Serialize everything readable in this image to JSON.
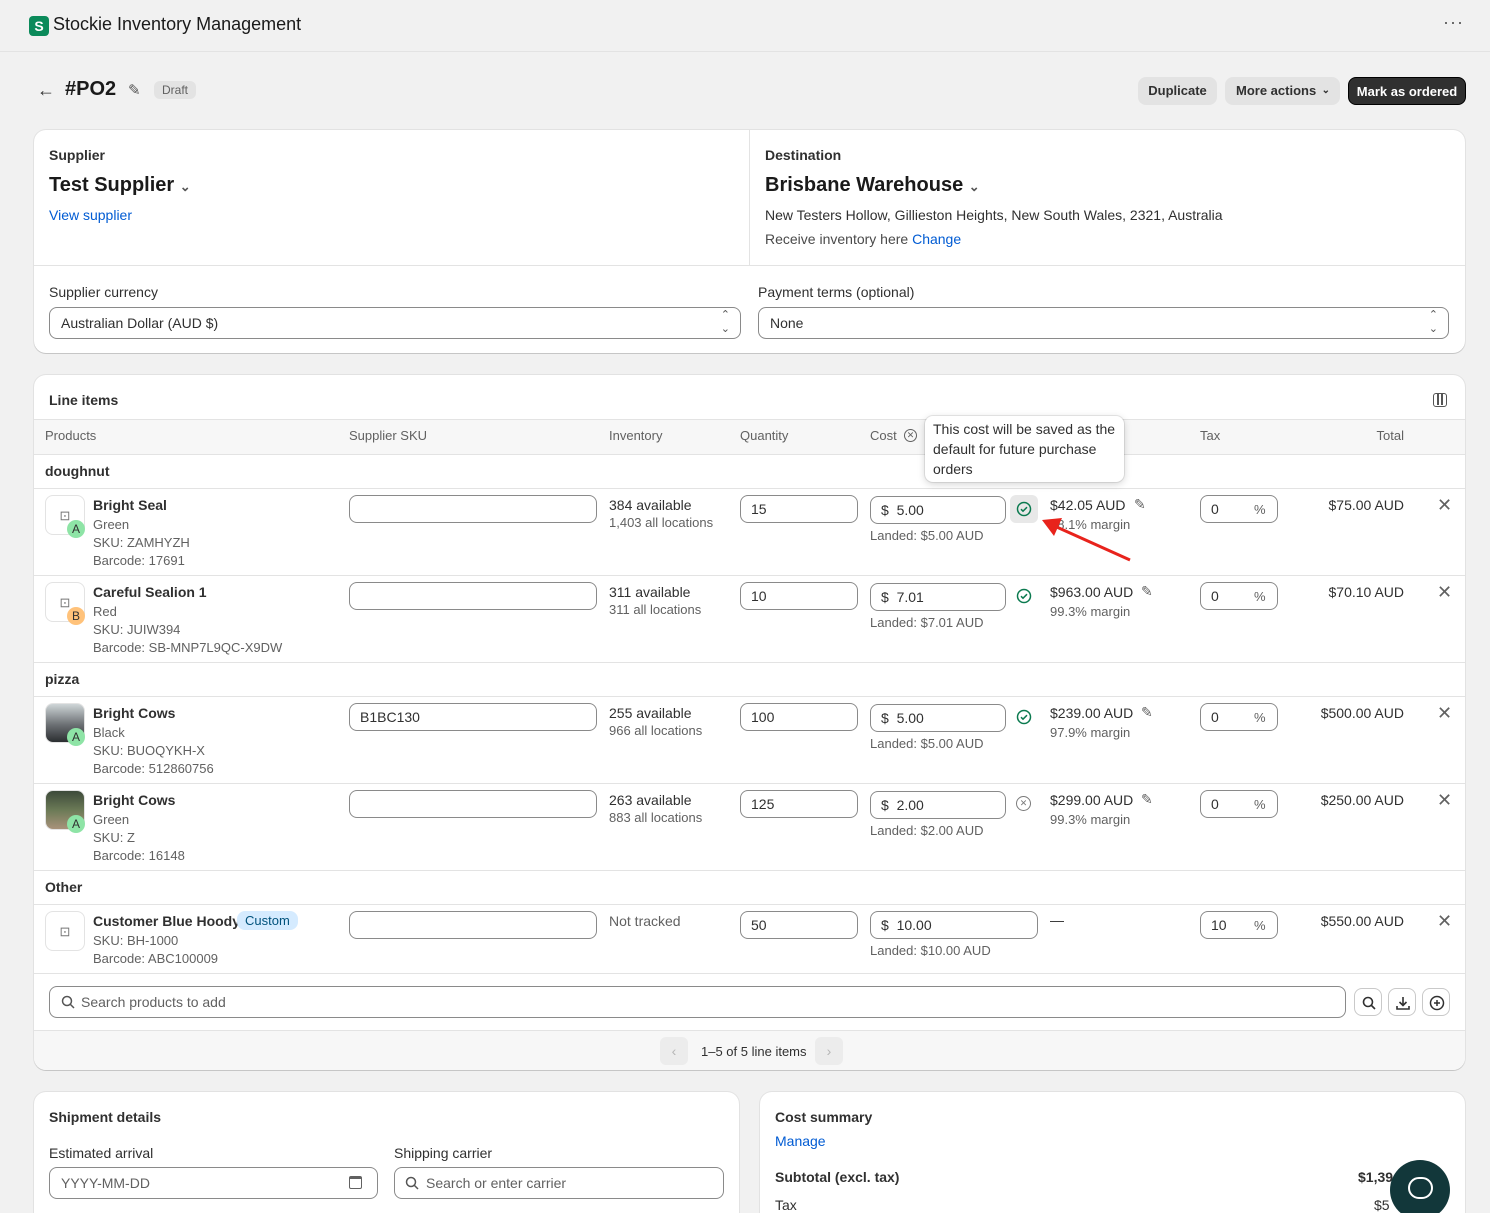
{
  "app": {
    "title": "Stockie Inventory Management",
    "logo_letter": "S"
  },
  "header": {
    "po_number": "#PO2",
    "status": "Draft",
    "duplicate_label": "Duplicate",
    "more_actions_label": "More actions",
    "mark_ordered_label": "Mark as ordered"
  },
  "supplier": {
    "label": "Supplier",
    "name": "Test Supplier",
    "view_link": "View supplier"
  },
  "destination": {
    "label": "Destination",
    "name": "Brisbane Warehouse",
    "address": "New Testers Hollow, Gillieston Heights, New South Wales, 2321, Australia",
    "receive_text": "Receive inventory here",
    "change_link": "Change"
  },
  "currency": {
    "label": "Supplier currency",
    "value": "Australian Dollar (AUD $)"
  },
  "payment_terms": {
    "label": "Payment terms (optional)",
    "value": "None"
  },
  "line_items": {
    "title": "Line items",
    "columns": {
      "products": "Products",
      "sku": "Supplier SKU",
      "inventory": "Inventory",
      "quantity": "Quantity",
      "cost": "Cost",
      "tax": "Tax",
      "total": "Total"
    },
    "tooltip": "This cost will be saved as the default for future purchase orders",
    "groups": [
      "doughnut",
      "pizza",
      "Other"
    ],
    "rows": [
      {
        "name": "Bright Seal",
        "variant": "Green",
        "sku": "SKU: ZAMHYZH",
        "barcode": "Barcode: 17691",
        "badge": "A",
        "supplier_sku": "",
        "available": "384 available",
        "all_locations": "1,403 all locations",
        "quantity": "15",
        "currency_symbol": "$",
        "cost": "5.00",
        "landed": "Landed: $5.00 AUD",
        "price": "$42.05 AUD",
        "margin": "88.1% margin",
        "tax": "0",
        "pct": "%",
        "total": "$75.00 AUD"
      },
      {
        "name": "Careful Sealion 1",
        "variant": "Red",
        "sku": "SKU: JUIW394",
        "barcode": "Barcode: SB-MNP7L9QC-X9DW",
        "badge": "B",
        "supplier_sku": "",
        "available": "311 available",
        "all_locations": "311 all locations",
        "quantity": "10",
        "currency_symbol": "$",
        "cost": "7.01",
        "landed": "Landed: $7.01 AUD",
        "price": "$963.00 AUD",
        "margin": "99.3% margin",
        "tax": "0",
        "pct": "%",
        "total": "$70.10 AUD"
      },
      {
        "name": "Bright Cows",
        "variant": "Black",
        "sku": "SKU: BUOQYKH-X",
        "barcode": "Barcode: 512860756",
        "badge": "A",
        "supplier_sku": "B1BC130",
        "available": "255 available",
        "all_locations": "966 all locations",
        "quantity": "100",
        "currency_symbol": "$",
        "cost": "5.00",
        "landed": "Landed: $5.00 AUD",
        "price": "$239.00 AUD",
        "margin": "97.9% margin",
        "tax": "0",
        "pct": "%",
        "total": "$500.00 AUD"
      },
      {
        "name": "Bright Cows",
        "variant": "Green",
        "sku": "SKU: Z",
        "barcode": "Barcode: 16148",
        "badge": "A",
        "supplier_sku": "",
        "available": "263 available",
        "all_locations": "883 all locations",
        "quantity": "125",
        "currency_symbol": "$",
        "cost": "2.00",
        "landed": "Landed: $2.00 AUD",
        "price": "$299.00 AUD",
        "margin": "99.3% margin",
        "tax": "0",
        "pct": "%",
        "total": "$250.00 AUD"
      },
      {
        "name": "Customer Blue Hoody",
        "custom_badge": "Custom",
        "sku": "SKU: BH-1000",
        "barcode": "Barcode: ABC100009",
        "supplier_sku": "",
        "available": "Not tracked",
        "quantity": "50",
        "currency_symbol": "$",
        "cost": "10.00",
        "landed": "Landed: $10.00 AUD",
        "price": "—",
        "tax": "10",
        "pct": "%",
        "total": "$550.00 AUD"
      }
    ],
    "search_placeholder": "Search products to add",
    "pagination": "1–5 of 5 line items"
  },
  "shipment": {
    "title": "Shipment details",
    "arrival_label": "Estimated arrival",
    "arrival_placeholder": "YYYY-MM-DD",
    "carrier_label": "Shipping carrier",
    "carrier_placeholder": "Search or enter carrier"
  },
  "cost_summary": {
    "title": "Cost summary",
    "manage_link": "Manage",
    "subtotal_label": "Subtotal (excl. tax)",
    "subtotal_value": "$1,39",
    "tax_label": "Tax",
    "tax_value": "$5"
  },
  "colors": {
    "accent_green": "#0b8a5a",
    "link_blue": "#005bd3",
    "primary_button": "#303030",
    "annotation_arrow": "#e8231c"
  }
}
